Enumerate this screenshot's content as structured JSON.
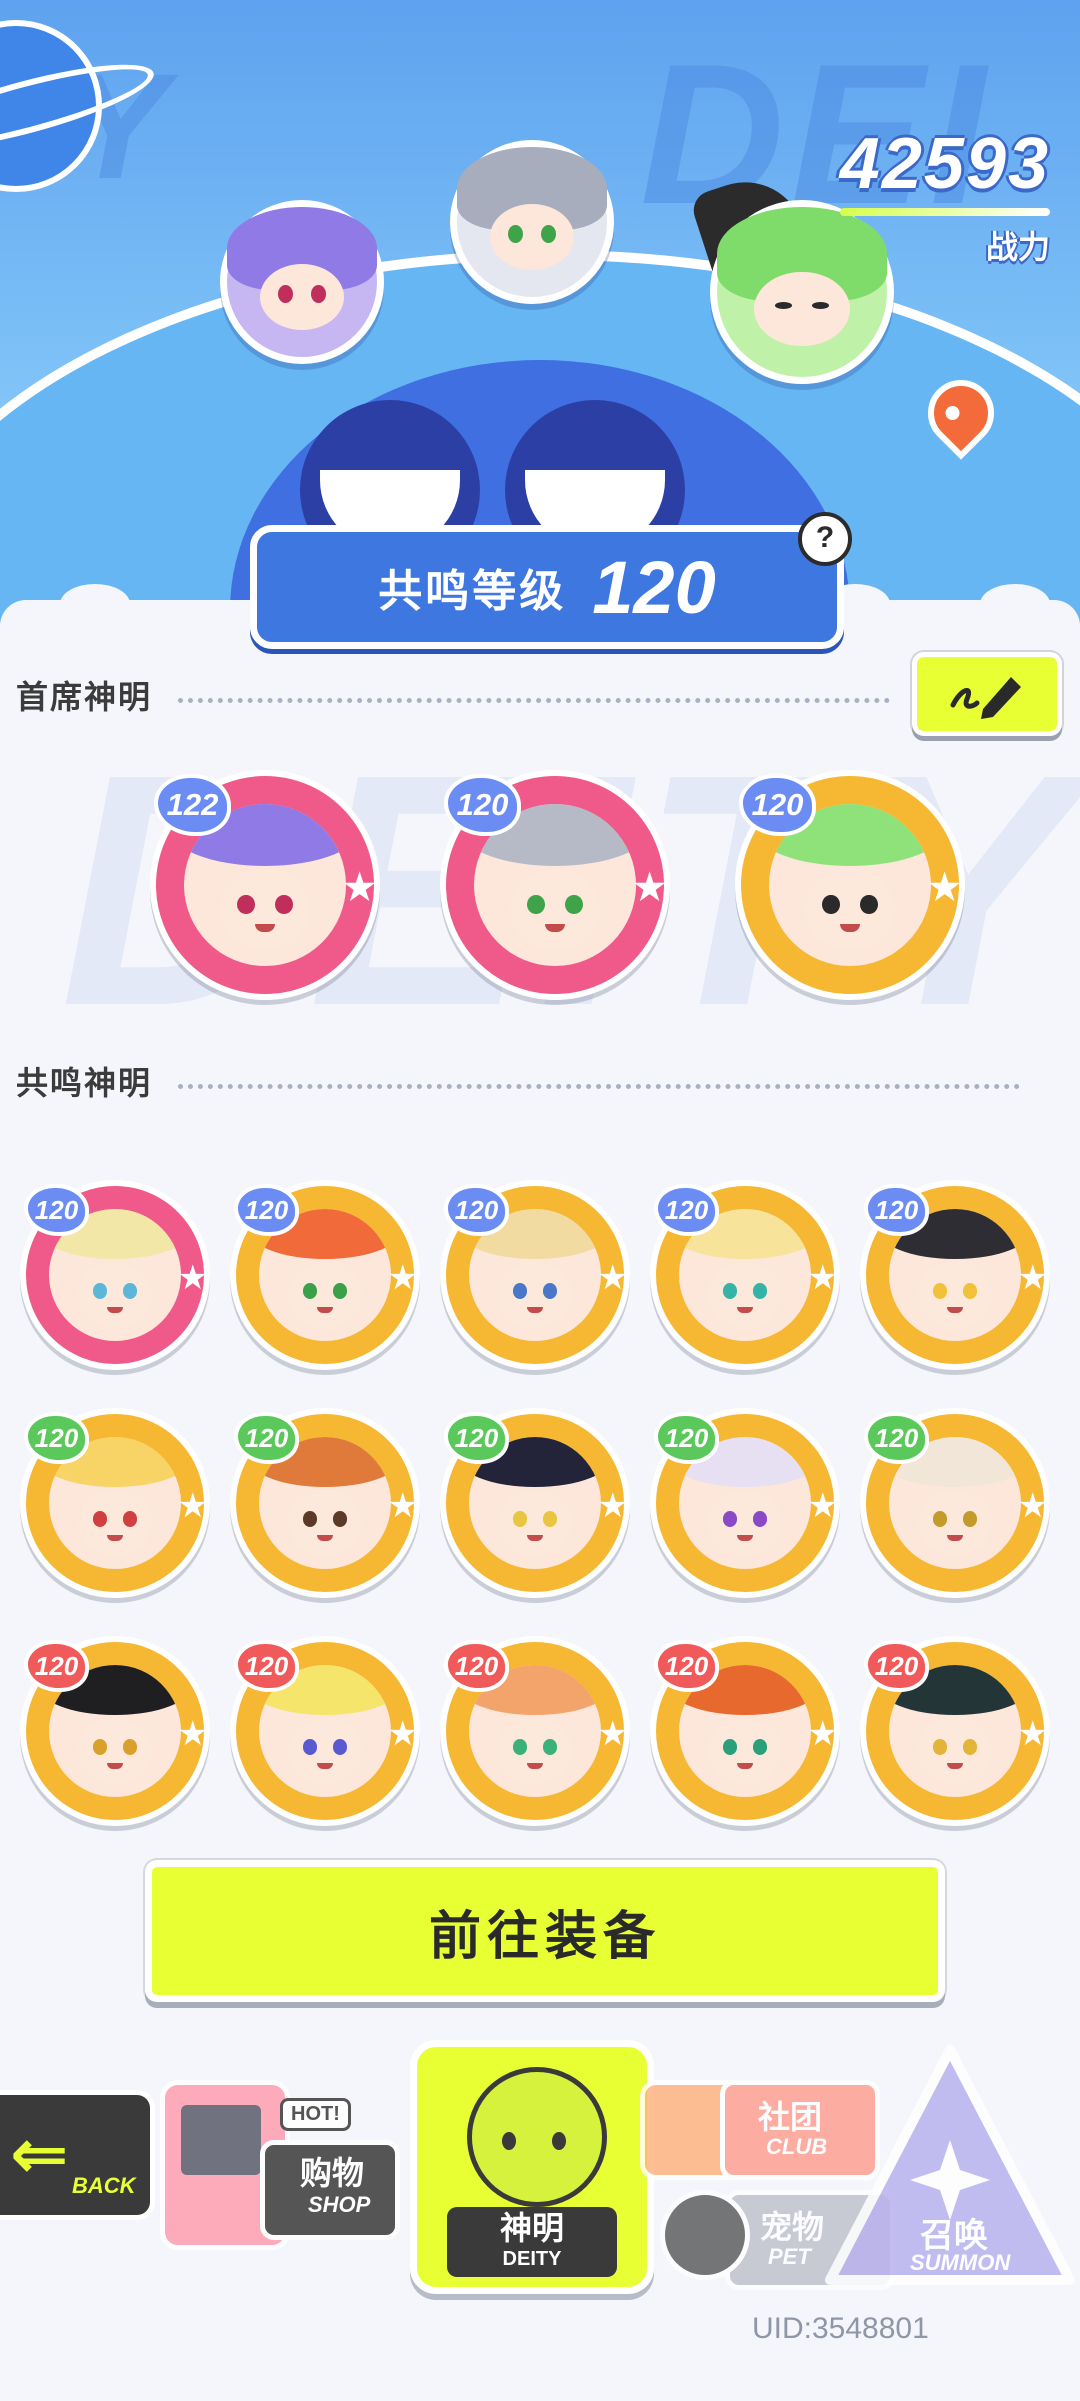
{
  "header": {
    "combat_power": "42593",
    "combat_power_label": "战力",
    "resonance_label": "共鸣等级",
    "resonance_level": "120",
    "help": "?"
  },
  "sections": {
    "chief_deities_title": "首席神明",
    "resonance_deities_title": "共鸣神明"
  },
  "chief_deities": [
    {
      "level": "122",
      "frame": "pink",
      "hair": "#8f7ae6",
      "eyes": "#c02e5c"
    },
    {
      "level": "120",
      "frame": "pink",
      "hair": "#b5bac6",
      "eyes": "#3fa34a"
    },
    {
      "level": "120",
      "frame": "gold",
      "hair": "#8fe27a",
      "eyes": "#2a2a2a"
    }
  ],
  "resonance_deities": [
    {
      "level": "120",
      "frame": "pink",
      "hair": "#f3e7a8",
      "eyes": "#5bb6d8"
    },
    {
      "level": "120",
      "frame": "gold",
      "hair": "#f06a3a",
      "eyes": "#3aa14a"
    },
    {
      "level": "120",
      "frame": "gold",
      "hair": "#f2dba0",
      "eyes": "#4a78c8"
    },
    {
      "level": "120",
      "frame": "gold",
      "hair": "#f7e49a",
      "eyes": "#36b3a7"
    },
    {
      "level": "120",
      "frame": "gold",
      "hair": "#2d2d33",
      "eyes": "#f2c13a"
    },
    {
      "level": "120",
      "frame": "gold",
      "hair": "#f7d465",
      "eyes": "#d04040"
    },
    {
      "level": "120",
      "frame": "gold",
      "hair": "#e07a3a",
      "eyes": "#5b3a2a"
    },
    {
      "level": "120",
      "frame": "gold",
      "hair": "#23233a",
      "eyes": "#e8c640"
    },
    {
      "level": "120",
      "frame": "gold",
      "hair": "#e7dff2",
      "eyes": "#8a4ac8"
    },
    {
      "level": "120",
      "frame": "gold",
      "hair": "#f2e6d8",
      "eyes": "#c49a2a"
    },
    {
      "level": "120",
      "frame": "gold",
      "hair": "#1f1f22",
      "eyes": "#d9a12b"
    },
    {
      "level": "120",
      "frame": "gold",
      "hair": "#f5e56b",
      "eyes": "#5a5ad0"
    },
    {
      "level": "120",
      "frame": "gold",
      "hair": "#f3a46a",
      "eyes": "#3ab07a"
    },
    {
      "level": "120",
      "frame": "gold",
      "hair": "#e8692e",
      "eyes": "#2aa07a"
    },
    {
      "level": "120",
      "frame": "gold",
      "hair": "#243538",
      "eyes": "#e3b43a"
    }
  ],
  "actions": {
    "go_equip": "前往装备"
  },
  "nav": {
    "back": "BACK",
    "shop_cn": "购物",
    "shop_en": "SHOP",
    "shop_hot": "HOT!",
    "deity_cn": "神明",
    "deity_en": "DEITY",
    "club_cn": "社团",
    "club_en": "CLUB",
    "pet_cn": "宠物",
    "pet_en": "PET",
    "summon_cn": "召唤",
    "summon_en": "SUMMON"
  },
  "uid": "UID:3548801",
  "icons": {
    "edit": "pencil-icon",
    "back": "arrow-left-icon",
    "location": "map-pin-icon",
    "help": "question-icon"
  },
  "colors": {
    "accent_lime": "#e7ff33",
    "hero_blue": "#3e77df",
    "frame_pink": "#ef5a8a",
    "frame_gold": "#f6b833",
    "dark": "#3a3a3a"
  }
}
